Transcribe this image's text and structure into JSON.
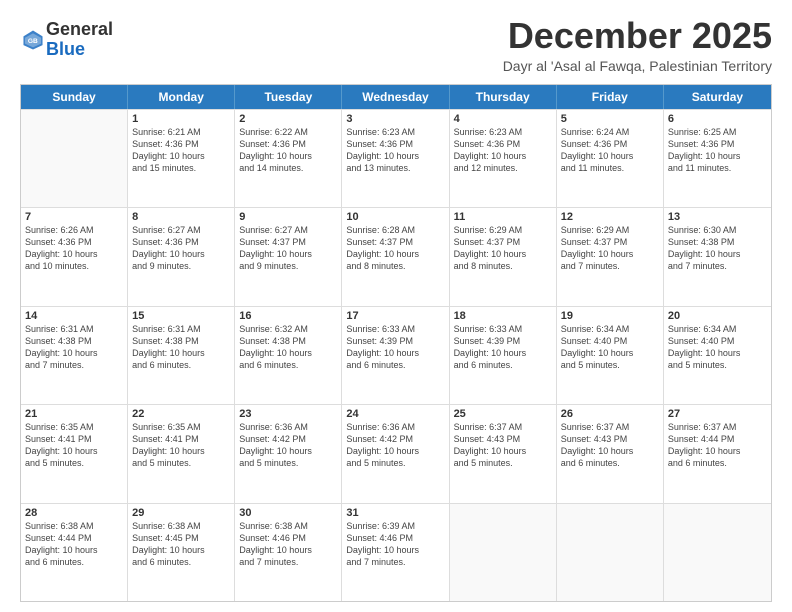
{
  "logo": {
    "general": "General",
    "blue": "Blue"
  },
  "header": {
    "title": "December 2025",
    "subtitle": "Dayr al 'Asal al Fawqa, Palestinian Territory"
  },
  "days": [
    "Sunday",
    "Monday",
    "Tuesday",
    "Wednesday",
    "Thursday",
    "Friday",
    "Saturday"
  ],
  "weeks": [
    [
      {
        "day": "",
        "lines": []
      },
      {
        "day": "1",
        "lines": [
          "Sunrise: 6:21 AM",
          "Sunset: 4:36 PM",
          "Daylight: 10 hours",
          "and 15 minutes."
        ]
      },
      {
        "day": "2",
        "lines": [
          "Sunrise: 6:22 AM",
          "Sunset: 4:36 PM",
          "Daylight: 10 hours",
          "and 14 minutes."
        ]
      },
      {
        "day": "3",
        "lines": [
          "Sunrise: 6:23 AM",
          "Sunset: 4:36 PM",
          "Daylight: 10 hours",
          "and 13 minutes."
        ]
      },
      {
        "day": "4",
        "lines": [
          "Sunrise: 6:23 AM",
          "Sunset: 4:36 PM",
          "Daylight: 10 hours",
          "and 12 minutes."
        ]
      },
      {
        "day": "5",
        "lines": [
          "Sunrise: 6:24 AM",
          "Sunset: 4:36 PM",
          "Daylight: 10 hours",
          "and 11 minutes."
        ]
      },
      {
        "day": "6",
        "lines": [
          "Sunrise: 6:25 AM",
          "Sunset: 4:36 PM",
          "Daylight: 10 hours",
          "and 11 minutes."
        ]
      }
    ],
    [
      {
        "day": "7",
        "lines": [
          "Sunrise: 6:26 AM",
          "Sunset: 4:36 PM",
          "Daylight: 10 hours",
          "and 10 minutes."
        ]
      },
      {
        "day": "8",
        "lines": [
          "Sunrise: 6:27 AM",
          "Sunset: 4:36 PM",
          "Daylight: 10 hours",
          "and 9 minutes."
        ]
      },
      {
        "day": "9",
        "lines": [
          "Sunrise: 6:27 AM",
          "Sunset: 4:37 PM",
          "Daylight: 10 hours",
          "and 9 minutes."
        ]
      },
      {
        "day": "10",
        "lines": [
          "Sunrise: 6:28 AM",
          "Sunset: 4:37 PM",
          "Daylight: 10 hours",
          "and 8 minutes."
        ]
      },
      {
        "day": "11",
        "lines": [
          "Sunrise: 6:29 AM",
          "Sunset: 4:37 PM",
          "Daylight: 10 hours",
          "and 8 minutes."
        ]
      },
      {
        "day": "12",
        "lines": [
          "Sunrise: 6:29 AM",
          "Sunset: 4:37 PM",
          "Daylight: 10 hours",
          "and 7 minutes."
        ]
      },
      {
        "day": "13",
        "lines": [
          "Sunrise: 6:30 AM",
          "Sunset: 4:38 PM",
          "Daylight: 10 hours",
          "and 7 minutes."
        ]
      }
    ],
    [
      {
        "day": "14",
        "lines": [
          "Sunrise: 6:31 AM",
          "Sunset: 4:38 PM",
          "Daylight: 10 hours",
          "and 7 minutes."
        ]
      },
      {
        "day": "15",
        "lines": [
          "Sunrise: 6:31 AM",
          "Sunset: 4:38 PM",
          "Daylight: 10 hours",
          "and 6 minutes."
        ]
      },
      {
        "day": "16",
        "lines": [
          "Sunrise: 6:32 AM",
          "Sunset: 4:38 PM",
          "Daylight: 10 hours",
          "and 6 minutes."
        ]
      },
      {
        "day": "17",
        "lines": [
          "Sunrise: 6:33 AM",
          "Sunset: 4:39 PM",
          "Daylight: 10 hours",
          "and 6 minutes."
        ]
      },
      {
        "day": "18",
        "lines": [
          "Sunrise: 6:33 AM",
          "Sunset: 4:39 PM",
          "Daylight: 10 hours",
          "and 6 minutes."
        ]
      },
      {
        "day": "19",
        "lines": [
          "Sunrise: 6:34 AM",
          "Sunset: 4:40 PM",
          "Daylight: 10 hours",
          "and 5 minutes."
        ]
      },
      {
        "day": "20",
        "lines": [
          "Sunrise: 6:34 AM",
          "Sunset: 4:40 PM",
          "Daylight: 10 hours",
          "and 5 minutes."
        ]
      }
    ],
    [
      {
        "day": "21",
        "lines": [
          "Sunrise: 6:35 AM",
          "Sunset: 4:41 PM",
          "Daylight: 10 hours",
          "and 5 minutes."
        ]
      },
      {
        "day": "22",
        "lines": [
          "Sunrise: 6:35 AM",
          "Sunset: 4:41 PM",
          "Daylight: 10 hours",
          "and 5 minutes."
        ]
      },
      {
        "day": "23",
        "lines": [
          "Sunrise: 6:36 AM",
          "Sunset: 4:42 PM",
          "Daylight: 10 hours",
          "and 5 minutes."
        ]
      },
      {
        "day": "24",
        "lines": [
          "Sunrise: 6:36 AM",
          "Sunset: 4:42 PM",
          "Daylight: 10 hours",
          "and 5 minutes."
        ]
      },
      {
        "day": "25",
        "lines": [
          "Sunrise: 6:37 AM",
          "Sunset: 4:43 PM",
          "Daylight: 10 hours",
          "and 5 minutes."
        ]
      },
      {
        "day": "26",
        "lines": [
          "Sunrise: 6:37 AM",
          "Sunset: 4:43 PM",
          "Daylight: 10 hours",
          "and 6 minutes."
        ]
      },
      {
        "day": "27",
        "lines": [
          "Sunrise: 6:37 AM",
          "Sunset: 4:44 PM",
          "Daylight: 10 hours",
          "and 6 minutes."
        ]
      }
    ],
    [
      {
        "day": "28",
        "lines": [
          "Sunrise: 6:38 AM",
          "Sunset: 4:44 PM",
          "Daylight: 10 hours",
          "and 6 minutes."
        ]
      },
      {
        "day": "29",
        "lines": [
          "Sunrise: 6:38 AM",
          "Sunset: 4:45 PM",
          "Daylight: 10 hours",
          "and 6 minutes."
        ]
      },
      {
        "day": "30",
        "lines": [
          "Sunrise: 6:38 AM",
          "Sunset: 4:46 PM",
          "Daylight: 10 hours",
          "and 7 minutes."
        ]
      },
      {
        "day": "31",
        "lines": [
          "Sunrise: 6:39 AM",
          "Sunset: 4:46 PM",
          "Daylight: 10 hours",
          "and 7 minutes."
        ]
      },
      {
        "day": "",
        "lines": []
      },
      {
        "day": "",
        "lines": []
      },
      {
        "day": "",
        "lines": []
      }
    ]
  ]
}
